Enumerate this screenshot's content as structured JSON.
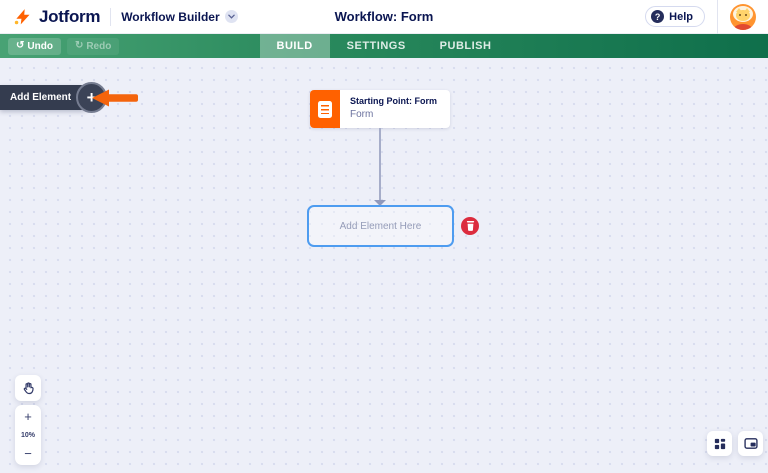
{
  "header": {
    "brand": "Jotform",
    "product": "Workflow Builder",
    "title": "Workflow: Form",
    "help_label": "Help",
    "help_glyph": "?"
  },
  "toolbar": {
    "undo_label": "Undo",
    "redo_label": "Redo",
    "undo_glyph": "↺",
    "redo_glyph": "↻",
    "tabs": [
      {
        "label": "BUILD",
        "active": true
      },
      {
        "label": "SETTINGS",
        "active": false
      },
      {
        "label": "PUBLISH",
        "active": false
      }
    ]
  },
  "canvas": {
    "add_element_label": "Add Element",
    "plus_label": "+",
    "start_node": {
      "title": "Starting Point: Form",
      "subtitle": "Form",
      "icon": "form-document-icon"
    },
    "placeholder": {
      "label": "Add Element Here"
    },
    "delete_icon": "trash-icon",
    "annotation": "orange-arrow-pointing-left-at-add-element"
  },
  "zoom_controls": {
    "pan_icon": "hand-pan-icon",
    "zoom_in_label": "+",
    "zoom_level": "10%",
    "zoom_out_label": "−"
  },
  "corner_tools": {
    "grid_icon": "elements-grid-icon",
    "minimap_icon": "minimap-icon"
  },
  "colors": {
    "brand_navy": "#0a1551",
    "toolbar_green_start": "#48a274",
    "toolbar_green_end": "#0f6f4b",
    "accent_orange": "#ff6100",
    "node_border_blue": "#4e9cf0",
    "delete_red": "#dc2c3e",
    "canvas_bg": "#edeff8"
  }
}
